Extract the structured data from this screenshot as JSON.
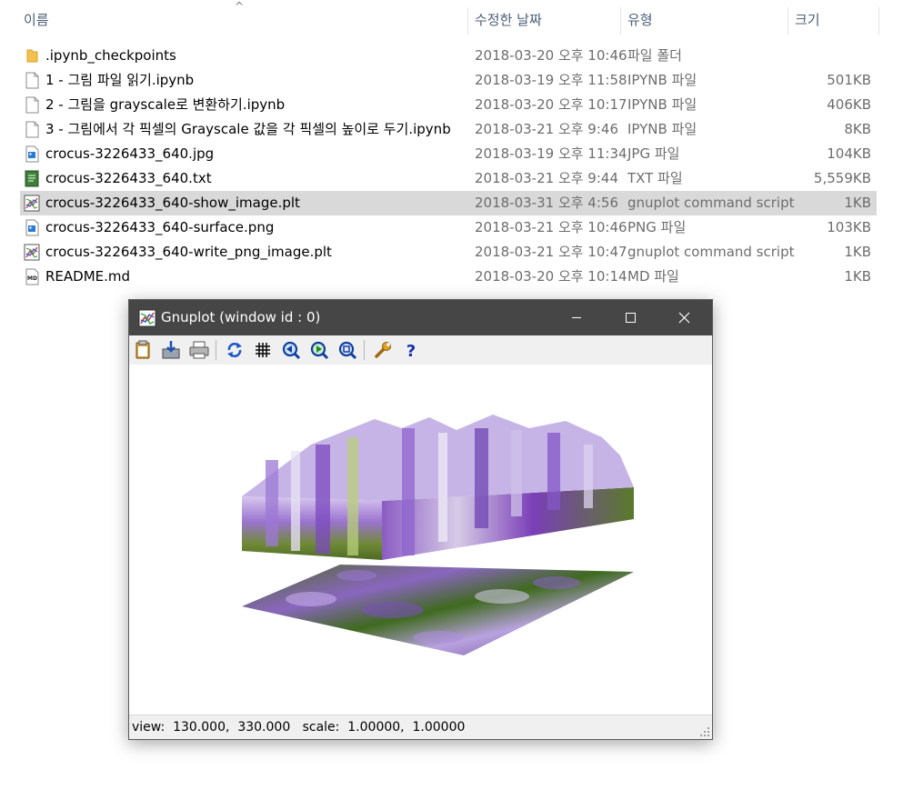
{
  "explorer": {
    "columns": {
      "name": "이름",
      "date": "수정한 날짜",
      "type": "유형",
      "size": "크기"
    },
    "sort_icon": "^",
    "files": [
      {
        "name": ".ipynb_checkpoints",
        "date": "2018-03-20 오후 10:46",
        "type": "파일 폴더",
        "size": "",
        "icon": "folder-icon"
      },
      {
        "name": "1 - 그림 파일 읽기.ipynb",
        "date": "2018-03-19 오후 11:58",
        "type": "IPYNB 파일",
        "size": "501KB",
        "icon": "file-icon"
      },
      {
        "name": "2 - 그림을 grayscale로 변환하기.ipynb",
        "date": "2018-03-20 오후 10:17",
        "type": "IPYNB 파일",
        "size": "406KB",
        "icon": "file-icon"
      },
      {
        "name": "3 - 그림에서 각 픽셀의 Grayscale 값을 각 픽셀의 높이로 두기.ipynb",
        "date": "2018-03-21 오후 9:46",
        "type": "IPYNB 파일",
        "size": "8KB",
        "icon": "file-icon"
      },
      {
        "name": "crocus-3226433_640.jpg",
        "date": "2018-03-19 오후 11:34",
        "type": "JPG 파일",
        "size": "104KB",
        "icon": "image-file-icon"
      },
      {
        "name": "crocus-3226433_640.txt",
        "date": "2018-03-21 오후 9:44",
        "type": "TXT 파일",
        "size": "5,559KB",
        "icon": "text-file-icon"
      },
      {
        "name": "crocus-3226433_640-show_image.plt",
        "date": "2018-03-31 오후 4:56",
        "type": "gnuplot command script",
        "size": "1KB",
        "icon": "gnuplot-file-icon"
      },
      {
        "name": "crocus-3226433_640-surface.png",
        "date": "2018-03-21 오후 10:46",
        "type": "PNG 파일",
        "size": "103KB",
        "icon": "image-file-icon"
      },
      {
        "name": "crocus-3226433_640-write_png_image.plt",
        "date": "2018-03-21 오후 10:47",
        "type": "gnuplot command script",
        "size": "1KB",
        "icon": "gnuplot-file-icon"
      },
      {
        "name": "README.md",
        "date": "2018-03-20 오후 10:14",
        "type": "MD 파일",
        "size": "1KB",
        "icon": "markdown-file-icon"
      }
    ],
    "selected_index": 6
  },
  "gnuplot_window": {
    "title": "Gnuplot (window id : 0)",
    "status": "view:  130.000,  330.000   scale:  1.00000,  1.00000",
    "toolbar": [
      "copy-clipboard-icon",
      "save-icon",
      "print-icon",
      "replot-icon",
      "grid-icon",
      "zoom-previous-icon",
      "zoom-next-icon",
      "unzoom-icon",
      "options-icon",
      "help-icon"
    ]
  },
  "colors": {
    "titlebar": "#464646",
    "selection": "#d9d9d9",
    "header_text": "#4c607a"
  }
}
